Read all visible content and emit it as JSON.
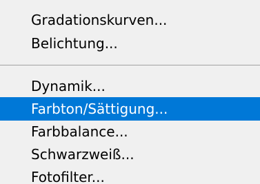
{
  "menu": {
    "groups": [
      {
        "items": [
          {
            "label": "Gradationskurven..."
          },
          {
            "label": "Belichtung..."
          }
        ]
      },
      {
        "items": [
          {
            "label": "Dynamik..."
          },
          {
            "label": "Farbton/Sättigung...",
            "highlighted": true
          },
          {
            "label": "Farbbalance..."
          },
          {
            "label": "Schwarzweiß..."
          },
          {
            "label": "Fotofilter..."
          }
        ]
      }
    ]
  },
  "colors": {
    "menu_background": "#f0f0f0",
    "highlight_background": "#0078d7",
    "highlight_text": "#ffffff",
    "text": "#000000",
    "separator": "#a0a0a0"
  }
}
